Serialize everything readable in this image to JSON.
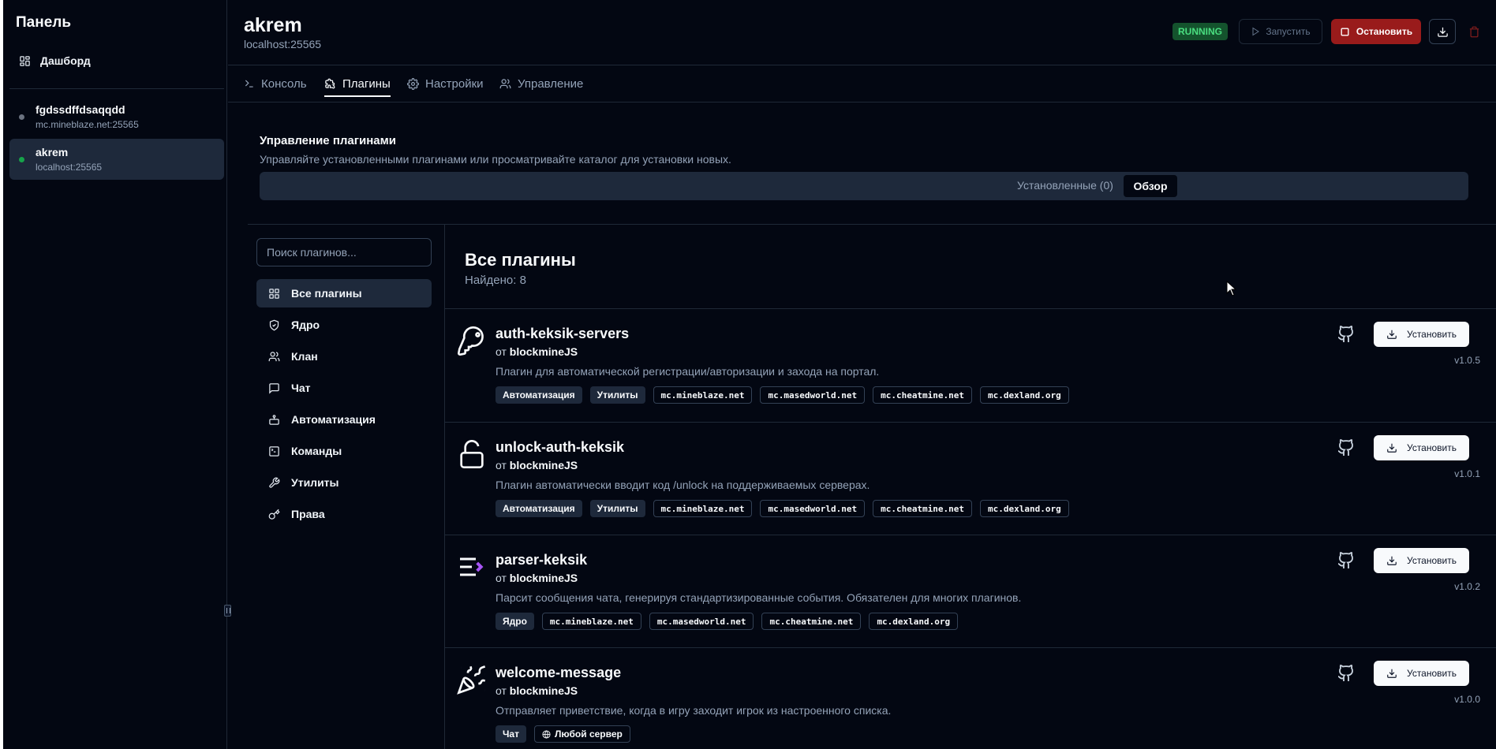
{
  "sidebar": {
    "title": "Панель",
    "dashboard_label": "Дашборд",
    "servers": [
      {
        "name": "fgdssdffdsaqqdd",
        "host": "mc.mineblaze.net:25565",
        "status_color": "#6b7280"
      },
      {
        "name": "akrem",
        "host": "localhost:25565",
        "status_color": "#16a34a"
      }
    ]
  },
  "header": {
    "title": "akrem",
    "host": "localhost:25565",
    "status_badge": "RUNNING",
    "start_label": "Запустить",
    "stop_label": "Остановить"
  },
  "tabs": [
    {
      "label": "Консоль",
      "icon": "terminal-icon"
    },
    {
      "label": "Плагины",
      "icon": "puzzle-icon"
    },
    {
      "label": "Настройки",
      "icon": "gear-icon"
    },
    {
      "label": "Управление",
      "icon": "users-icon"
    }
  ],
  "plugins_manager": {
    "title": "Управление плагинами",
    "subtitle": "Управляйте установленными плагинами или просматривайте каталог для установки новых.",
    "tab_installed": "Установленные (0)",
    "tab_overview": "Обзор"
  },
  "search": {
    "placeholder": "Поиск плагинов..."
  },
  "categories": [
    {
      "label": "Все плагины",
      "icon": "grid-icon"
    },
    {
      "label": "Ядро",
      "icon": "shield-icon"
    },
    {
      "label": "Клан",
      "icon": "users-icon"
    },
    {
      "label": "Чат",
      "icon": "message-icon"
    },
    {
      "label": "Автоматизация",
      "icon": "bot-icon"
    },
    {
      "label": "Команды",
      "icon": "terminal-square-icon"
    },
    {
      "label": "Утилиты",
      "icon": "wrench-icon"
    },
    {
      "label": "Права",
      "icon": "key-icon"
    }
  ],
  "list": {
    "title": "Все плагины",
    "found": "Найдено: 8",
    "by_prefix": "от"
  },
  "plugins": [
    {
      "name": "auth-keksik-servers",
      "author": "blockmineJS",
      "description": "Плагин для автоматической регистрации/авторизации и захода на портал.",
      "icon": "key-icon",
      "tags": [
        "Автоматизация",
        "Утилиты"
      ],
      "servers": [
        "mc.mineblaze.net",
        "mc.masedworld.net",
        "mc.cheatmine.net",
        "mc.dexland.org"
      ],
      "install_label": "Установить",
      "version": "v1.0.5"
    },
    {
      "name": "unlock-auth-keksik",
      "author": "blockmineJS",
      "description": "Плагин автоматически вводит код /unlock на поддерживаемых серверах.",
      "icon": "lock-open-icon",
      "tags": [
        "Автоматизация",
        "Утилиты"
      ],
      "servers": [
        "mc.mineblaze.net",
        "mc.masedworld.net",
        "mc.cheatmine.net",
        "mc.dexland.org"
      ],
      "install_label": "Установить",
      "version": "v1.0.1"
    },
    {
      "name": "parser-keksik",
      "author": "blockmineJS",
      "description": "Парсит сообщения чата, генерируя стандартизированные события. Обязателен для многих плагинов.",
      "icon": "parser-icon",
      "tags": [
        "Ядро"
      ],
      "servers": [
        "mc.mineblaze.net",
        "mc.masedworld.net",
        "mc.cheatmine.net",
        "mc.dexland.org"
      ],
      "install_label": "Установить",
      "version": "v1.0.2"
    },
    {
      "name": "welcome-message",
      "author": "blockmineJS",
      "description": "Отправляет приветствие, когда в игру заходит игрок из настроенного списка.",
      "icon": "party-popper-icon",
      "tags": [
        "Чат"
      ],
      "any_server_label": "Любой сервер",
      "install_label": "Установить",
      "version": "v1.0.0"
    }
  ],
  "colors": {
    "accent_stop": "#991b1b",
    "running": "#4ade80",
    "parser_accent": "#a855f7"
  }
}
